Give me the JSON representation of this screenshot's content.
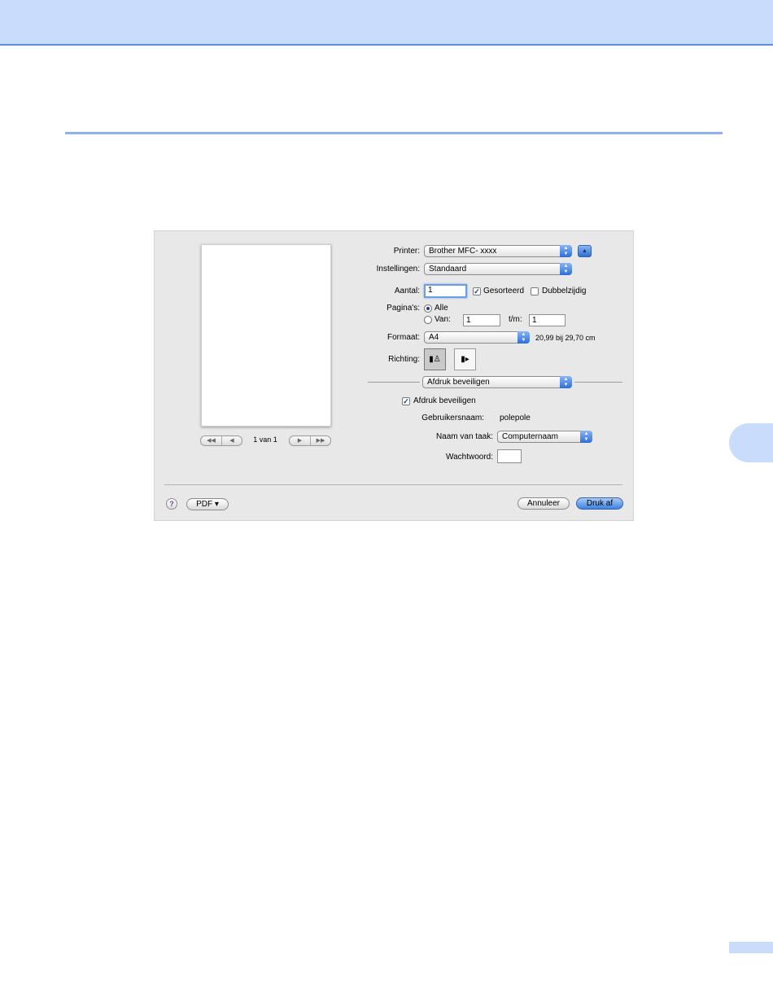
{
  "dialog": {
    "page_preview": {
      "page_count": "1 van 1"
    },
    "printer": {
      "label": "Printer:",
      "value": "Brother MFC- xxxx"
    },
    "presets": {
      "label": "Instellingen:",
      "value": "Standaard"
    },
    "copies": {
      "label": "Aantal:",
      "value": "1",
      "collated_label": "Gesorteerd",
      "collated_checked": true,
      "duplex_label": "Dubbelzijdig",
      "duplex_checked": false
    },
    "pages": {
      "label": "Pagina's:",
      "all_label": "Alle",
      "all_selected": true,
      "from_label": "Van:",
      "from_value": "1",
      "to_label": "t/m:",
      "to_value": "1"
    },
    "paper_size": {
      "label": "Formaat:",
      "value": "A4",
      "dimensions": "20,99 bij 29,70 cm"
    },
    "orientation": {
      "label": "Richting:",
      "selected": "portrait"
    },
    "panel_select": {
      "value": "Afdruk beveiligen"
    },
    "secure_print": {
      "checkbox_label": "Afdruk beveiligen",
      "checked": true,
      "username_label": "Gebruikersnaam:",
      "username_value": "polepole",
      "jobname_label": "Naam van taak:",
      "jobname_value": "Computernaam",
      "password_label": "Wachtwoord:",
      "password_value": ""
    },
    "footer": {
      "help": "?",
      "pdf_label": "PDF ▾",
      "cancel_label": "Annuleer",
      "print_label": "Druk af"
    }
  },
  "colors": {
    "header_band": "#cadcfb",
    "accent": "#3d82e3"
  }
}
